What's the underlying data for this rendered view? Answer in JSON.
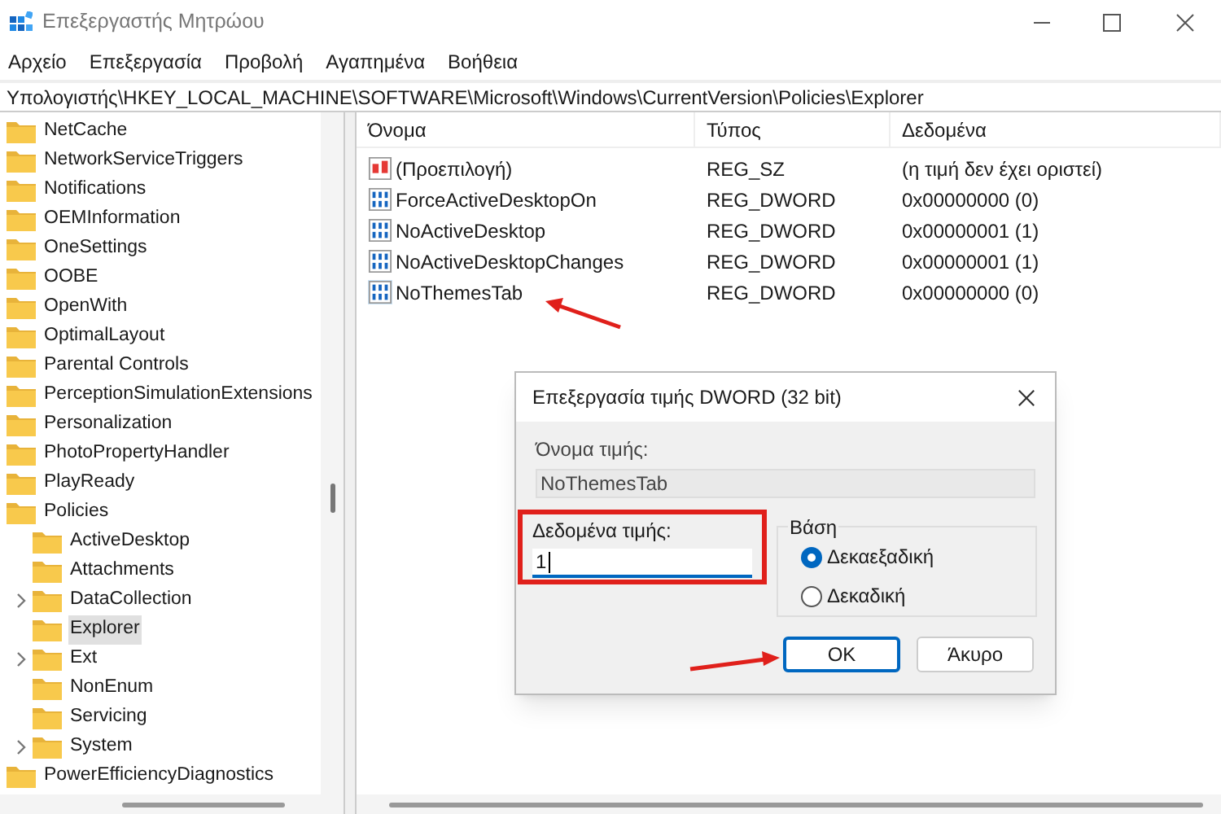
{
  "window": {
    "title": "Επεξεργαστής Μητρώου"
  },
  "menu": [
    "Αρχείο",
    "Επεξεργασία",
    "Προβολή",
    "Αγαπημένα",
    "Βοήθεια"
  ],
  "address": "Υπολογιστής\\HKEY_LOCAL_MACHINE\\SOFTWARE\\Microsoft\\Windows\\CurrentVersion\\Policies\\Explorer",
  "tree": [
    {
      "label": "NetCache",
      "selected": false
    },
    {
      "label": "NetworkServiceTriggers",
      "selected": false
    },
    {
      "label": "Notifications",
      "selected": false
    },
    {
      "label": "OEMInformation",
      "selected": false
    },
    {
      "label": "OneSettings",
      "selected": false
    },
    {
      "label": "OOBE",
      "selected": false
    },
    {
      "label": "OpenWith",
      "selected": false
    },
    {
      "label": "OptimalLayout",
      "selected": false
    },
    {
      "label": "Parental Controls",
      "selected": false
    },
    {
      "label": "PerceptionSimulationExtensions",
      "selected": false
    },
    {
      "label": "Personalization",
      "selected": false
    },
    {
      "label": "PhotoPropertyHandler",
      "selected": false
    },
    {
      "label": "PlayReady",
      "selected": false
    },
    {
      "label": "Policies",
      "selected": false,
      "children": [
        {
          "label": "ActiveDesktop",
          "selected": false,
          "expandable": false
        },
        {
          "label": "Attachments",
          "selected": false,
          "expandable": false
        },
        {
          "label": "DataCollection",
          "selected": false,
          "expandable": true
        },
        {
          "label": "Explorer",
          "selected": true,
          "expandable": false
        },
        {
          "label": "Ext",
          "selected": false,
          "expandable": true
        },
        {
          "label": "NonEnum",
          "selected": false,
          "expandable": false
        },
        {
          "label": "Servicing",
          "selected": false,
          "expandable": false
        },
        {
          "label": "System",
          "selected": false,
          "expandable": true
        }
      ]
    },
    {
      "label": "PowerEfficiencyDiagnostics",
      "selected": false
    }
  ],
  "table": {
    "columns": [
      "Όνομα",
      "Τύπος",
      "Δεδομένα"
    ],
    "rows": [
      {
        "kind": "string",
        "name": "(Προεπιλογή)",
        "type": "REG_SZ",
        "data": "(η τιμή δεν έχει οριστεί)",
        "selected": false
      },
      {
        "kind": "dword",
        "name": "ForceActiveDesktopOn",
        "type": "REG_DWORD",
        "data": "0x00000000 (0)",
        "selected": false
      },
      {
        "kind": "dword",
        "name": "NoActiveDesktop",
        "type": "REG_DWORD",
        "data": "0x00000001 (1)",
        "selected": false
      },
      {
        "kind": "dword",
        "name": "NoActiveDesktopChanges",
        "type": "REG_DWORD",
        "data": "0x00000001 (1)",
        "selected": false
      },
      {
        "kind": "dword",
        "name": "NoThemesTab",
        "type": "REG_DWORD",
        "data": "0x00000000 (0)",
        "selected": true
      }
    ]
  },
  "dialog": {
    "title": "Επεξεργασία τιμής DWORD (32 bit)",
    "name_label": "Όνομα τιμής:",
    "name_value": "NoThemesTab",
    "data_label": "Δεδομένα τιμής:",
    "data_value": "1",
    "base_label": "Βάση",
    "bases": [
      {
        "label": "Δεκαεξαδική",
        "selected": true
      },
      {
        "label": "Δεκαδική",
        "selected": false
      }
    ],
    "buttons": [
      {
        "label": "OK",
        "default": true
      },
      {
        "label": "Άκυρο",
        "default": false
      }
    ]
  }
}
